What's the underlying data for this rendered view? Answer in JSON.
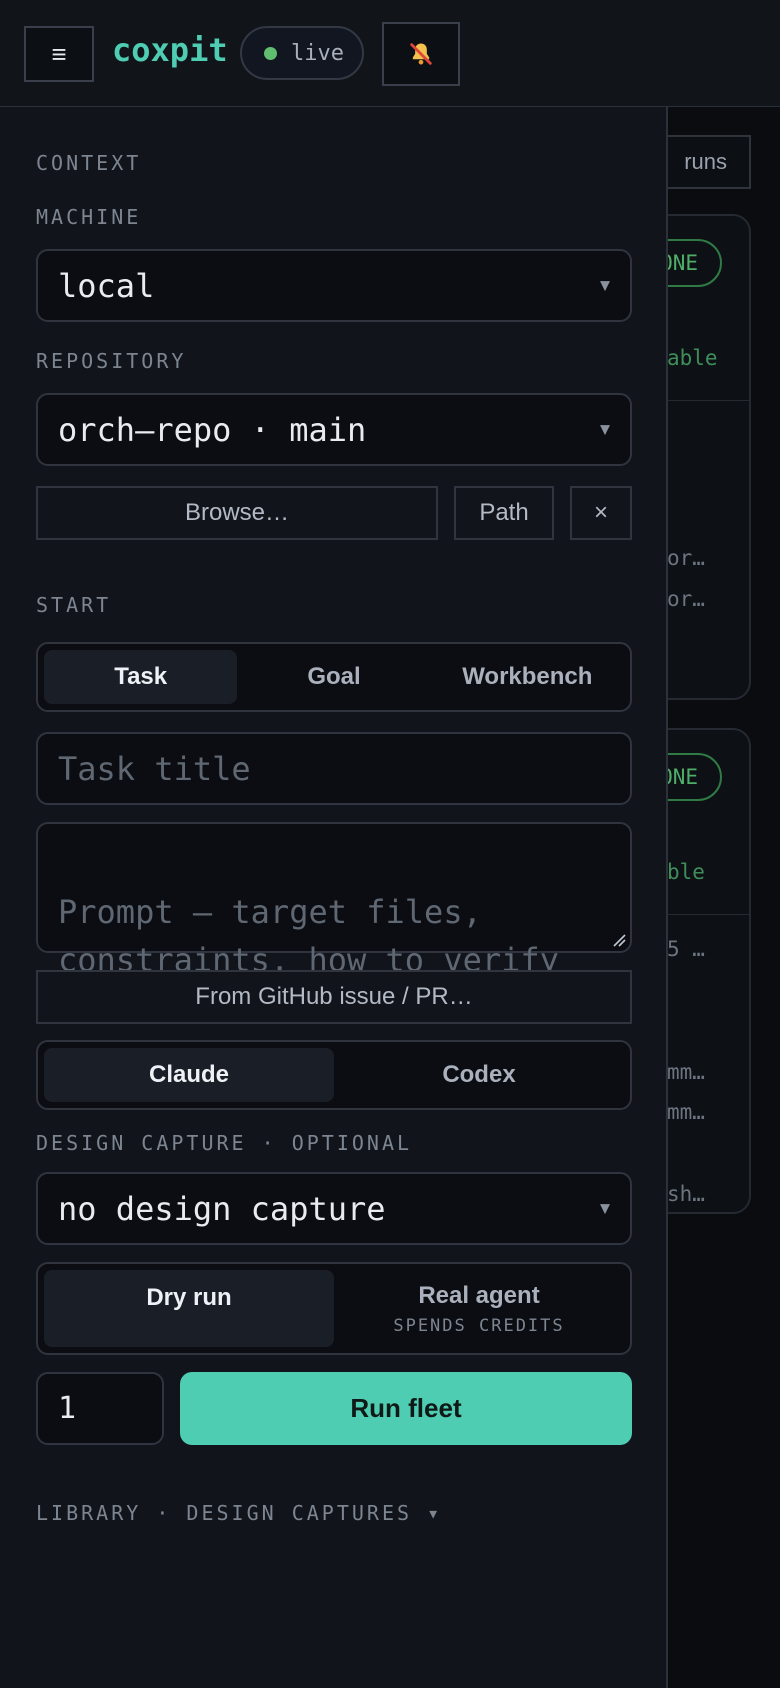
{
  "header": {
    "menu_icon": "≡",
    "brand": "coxpit",
    "status": "live",
    "bell_icon": "bell-muted-icon",
    "colors": {
      "accent": "#4ecdb2",
      "live": "#5fbf6f"
    }
  },
  "background": {
    "runs_label": "runs",
    "cards": [
      {
        "badge": "DONE",
        "lines": [
          "able",
          "or…",
          "or…"
        ]
      },
      {
        "badge": "DONE",
        "lines": [
          "ble",
          "5 …",
          "mm…",
          "mm…",
          "sh…"
        ]
      }
    ]
  },
  "drawer": {
    "context_label": "CONTEXT",
    "machine_label": "MACHINE",
    "machine_value": "local",
    "repository_label": "REPOSITORY",
    "repository_value": "orch–repo · main",
    "browse_label": "Browse…",
    "path_label": "Path",
    "clear_label": "×",
    "start_label": "START",
    "start_tabs": [
      "Task",
      "Goal",
      "Workbench"
    ],
    "task_title_placeholder": "Task title",
    "prompt_placeholder": "Prompt — target files,\nconstraints, how to verify",
    "github_label": "From GitHub issue / PR…",
    "agents": [
      "Claude",
      "Codex"
    ],
    "design_label": "DESIGN CAPTURE · OPTIONAL",
    "design_value": "no design capture",
    "mode_dry": "Dry run",
    "mode_real": "Real agent",
    "mode_real_sub": "SPENDS CREDITS",
    "quantity": "1",
    "run_label": "Run fleet",
    "library_label": "LIBRARY · DESIGN CAPTURES ▾"
  }
}
